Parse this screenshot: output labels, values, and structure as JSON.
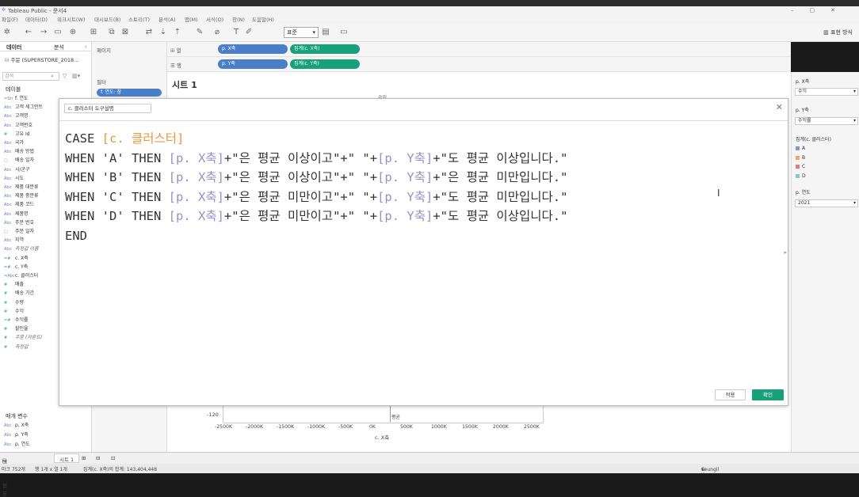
{
  "window": {
    "title": "Tableau Public - 문서4"
  },
  "menu": [
    "파일(F)",
    "데이터(D)",
    "워크시트(W)",
    "대시보드(B)",
    "스토리(T)",
    "분석(A)",
    "맵(M)",
    "서식(O)",
    "창(N)",
    "도움말(H)"
  ],
  "toolbar": {
    "mark_type": "표준",
    "show_me": "표현 방식"
  },
  "left": {
    "tab_data": "데이터",
    "tab_analytics": "분석",
    "datasource": "주문 (SUPERSTORE_2018...",
    "search_placeholder": "검색",
    "tables_header": "테이블",
    "fields": [
      {
        "icon": "=Str",
        "name": "f. 연도",
        "italic": false
      },
      {
        "icon": "Abc",
        "name": "고객 세그먼트",
        "italic": false
      },
      {
        "icon": "Abc",
        "name": "고객명",
        "italic": false
      },
      {
        "icon": "Abc",
        "name": "고객번호",
        "italic": false
      },
      {
        "icon": "#",
        "name": "고유 Id",
        "italic": false
      },
      {
        "icon": "Abc",
        "name": "국가",
        "italic": false
      },
      {
        "icon": "Abc",
        "name": "배송 방법",
        "italic": false
      },
      {
        "icon": "▢",
        "name": "배송 일자",
        "italic": false
      },
      {
        "icon": "Abc",
        "name": "시/군구",
        "italic": false
      },
      {
        "icon": "Abc",
        "name": "시도",
        "italic": false
      },
      {
        "icon": "Abc",
        "name": "제품 대분류",
        "italic": false
      },
      {
        "icon": "Abc",
        "name": "제품 중분류",
        "italic": false
      },
      {
        "icon": "Abc",
        "name": "제품 코드",
        "italic": false
      },
      {
        "icon": "Abc",
        "name": "제품명",
        "italic": false
      },
      {
        "icon": "Abc",
        "name": "주문 번호",
        "italic": false
      },
      {
        "icon": "▢",
        "name": "주문 일자",
        "italic": false
      },
      {
        "icon": "Abc",
        "name": "지역",
        "italic": false
      },
      {
        "icon": "Abc",
        "name": "측정값 이름",
        "italic": true
      },
      {
        "icon": "=#",
        "name": "c. X축",
        "italic": false
      },
      {
        "icon": "=#",
        "name": "c. Y축",
        "italic": false
      },
      {
        "icon": "=Abc",
        "name": "c. 클러스터",
        "italic": false
      },
      {
        "icon": "#",
        "name": "매출",
        "italic": false
      },
      {
        "icon": "#",
        "name": "배송 기간",
        "italic": false
      },
      {
        "icon": "#",
        "name": "수량",
        "italic": false
      },
      {
        "icon": "#",
        "name": "수익",
        "italic": false
      },
      {
        "icon": "=#",
        "name": "수익률",
        "italic": false
      },
      {
        "icon": "#",
        "name": "할인율",
        "italic": false
      },
      {
        "icon": "#",
        "name": "주문 (카운트)",
        "italic": true
      },
      {
        "icon": "#",
        "name": "측정값",
        "italic": true
      }
    ],
    "params_header": "매개 변수",
    "params": [
      {
        "icon": "Abc",
        "name": "p. X축"
      },
      {
        "icon": "Abc",
        "name": "p. Y축"
      },
      {
        "icon": "Abc",
        "name": "p. 연도"
      }
    ]
  },
  "mid": {
    "pages": "페이지",
    "filters": "필터",
    "filter_pill": "f. 연도: 참"
  },
  "shelves": {
    "columns_label": "iii 열",
    "rows_label": "☰ 행",
    "col_pills": [
      "p. X축",
      "집계(c. X축)"
    ],
    "row_pills": [
      "p. Y축",
      "집계(c. Y축)"
    ]
  },
  "canvas": {
    "sheet_title": "시트 1",
    "top_tick": "수익",
    "y_tick": "-120",
    "x_ticks": [
      "-2500K",
      "-2000K",
      "-1500K",
      "-1000K",
      "-500K",
      "0K",
      "500K",
      "1000K",
      "1500K",
      "2000K",
      "2500K"
    ],
    "x_title": "c. X축",
    "avg_label": "평균"
  },
  "right": {
    "px_label": "p. X축",
    "px_value": "수익",
    "py_label": "p. Y축",
    "py_value": "수익률",
    "legend_title": "집계(c. 클러스터)",
    "legend": [
      {
        "label": "A",
        "color": "#7b9bc7"
      },
      {
        "label": "B",
        "color": "#f0a868"
      },
      {
        "label": "C",
        "color": "#e07b7b"
      },
      {
        "label": "D",
        "color": "#8fc8b8"
      }
    ],
    "year_label": "p. 연도",
    "year_value": "2021"
  },
  "dialog": {
    "calc_name": "c. 클러스터 도구설명",
    "apply": "적용",
    "ok": "확인",
    "code_lines": [
      [
        {
          "t": "CASE ",
          "c": ""
        },
        {
          "t": "[c. 클러스터]",
          "c": "calc"
        }
      ],
      [
        {
          "t": "WHEN 'A' THEN ",
          "c": ""
        },
        {
          "t": "[p. X축]",
          "c": "fld"
        },
        {
          "t": "+\"은 평균 이상이고\"+\" \"+",
          "c": ""
        },
        {
          "t": "[p. Y축]",
          "c": "fld"
        },
        {
          "t": "+\"도 평균 이상입니다.\"",
          "c": ""
        }
      ],
      [
        {
          "t": "WHEN 'B' THEN ",
          "c": ""
        },
        {
          "t": "[p. X축]",
          "c": "fld"
        },
        {
          "t": "+\"은 평균 이상이고\"+\" \"+",
          "c": ""
        },
        {
          "t": "[p. Y축]",
          "c": "fld"
        },
        {
          "t": "+\"은 평균 미만입니다.\"",
          "c": ""
        }
      ],
      [
        {
          "t": "WHEN 'C' THEN ",
          "c": ""
        },
        {
          "t": "[p. X축]",
          "c": "fld"
        },
        {
          "t": "+\"은 평균 미만이고\"+\" \"+",
          "c": ""
        },
        {
          "t": "[p. Y축]",
          "c": "fld"
        },
        {
          "t": "+\"도 평균 미만입니다.\"",
          "c": ""
        }
      ],
      [
        {
          "t": "WHEN 'D' THEN ",
          "c": ""
        },
        {
          "t": "[p. X축]",
          "c": "fld"
        },
        {
          "t": "+\"은 평균 미만이고\"+\" \"+",
          "c": ""
        },
        {
          "t": "[p. Y축]",
          "c": "fld"
        },
        {
          "t": "+\"도 평균 이상입니다.\"",
          "c": ""
        }
      ],
      [
        {
          "t": "END",
          "c": ""
        }
      ]
    ]
  },
  "status": {
    "datasource_tab": "데이터 원본",
    "sheet_tab": "시트 1",
    "marks": "마크 752개",
    "rows_cols": "행 1개 x 열 1개",
    "sum": "집계(c. X축)의 합계: 143,404,448",
    "user": "Seungil Kang"
  }
}
